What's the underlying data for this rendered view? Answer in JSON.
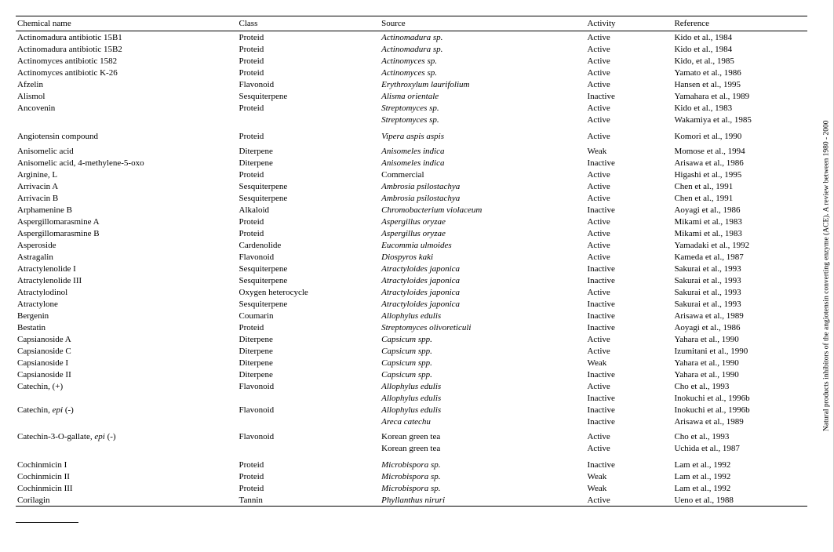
{
  "side_label": "Natural products inhibitors of the angiotensin converting enzyme (ACE). A review between 1980 - 2000",
  "table": {
    "headers": [
      "Chemical name",
      "Class",
      "Source",
      "Activity",
      "Reference"
    ],
    "rows": [
      [
        "Actinomadura antibiotic 15B1",
        "Proteid",
        "Actinomadura sp.",
        "Active",
        "Kido et al., 1984"
      ],
      [
        "Actinomadura antibiotic 15B2",
        "Proteid",
        "Actinomadura sp.",
        "Active",
        "Kido et al., 1984"
      ],
      [
        "Actinomyces antibiotic 1582",
        "Proteid",
        "Actinomyces sp.",
        "Active",
        "Kido, et al., 1985"
      ],
      [
        "Actinomyces antibiotic K-26",
        "Proteid",
        "Actinomyces sp.",
        "Active",
        "Yamato et al., 1986"
      ],
      [
        "Afzelin",
        "Flavonoid",
        "Erythroxylum laurifolium",
        "Active",
        "Hansen et al., 1995"
      ],
      [
        "Alismol",
        "Sesquiterpene",
        "Alisma orientale",
        "Inactive",
        "Yamahara et al., 1989"
      ],
      [
        "Ancovenin",
        "Proteid",
        "Streptomyces sp.",
        "Active",
        "Kido et al., 1983"
      ],
      [
        "",
        "",
        "Streptomyces sp.",
        "Active",
        "Wakamiya et al., 1985"
      ],
      [
        "Angiotensin compound",
        "Proteid",
        "Vipera aspis aspis",
        "Active",
        "Komori et al., 1990"
      ],
      [
        "Anisomelic acid",
        "Diterpene",
        "Anisomeles indica",
        "Weak",
        "Momose et al., 1994"
      ],
      [
        "Anisomelic acid, 4-methylene-5-oxo",
        "Diterpene",
        "Anisomeles indica",
        "Inactive",
        "Arisawa et al., 1986"
      ],
      [
        "Arginine, L",
        "Proteid",
        "Commercial",
        "Active",
        "Higashi et al., 1995"
      ],
      [
        "Arrivacin A",
        "Sesquiterpene",
        "Ambrosia psilostachya",
        "Active",
        "Chen et al., 1991"
      ],
      [
        "Arrivacin B",
        "Sesquiterpene",
        "Ambrosia psilostachya",
        "Active",
        "Chen et al., 1991"
      ],
      [
        "Arphamenine B",
        "Alkaloid",
        "Chromobacterium violaceum",
        "Inactive",
        "Aoyagi et al., 1986"
      ],
      [
        "Aspergillomarasmine A",
        "Proteid",
        "Aspergillus oryzae",
        "Active",
        "Mikami et al., 1983"
      ],
      [
        "Aspergillomarasmine B",
        "Proteid",
        "Aspergillus oryzae",
        "Active",
        "Mikami et al., 1983"
      ],
      [
        "Asperoside",
        "Cardenolide",
        "Eucommia ulmoides",
        "Active",
        "Yamadaki et al., 1992"
      ],
      [
        "Astragalin",
        "Flavonoid",
        "Diospyros kaki",
        "Active",
        "Kameda et al., 1987"
      ],
      [
        "Atractylenolide I",
        "Sesquiterpene",
        "Atractyloides japonica",
        "Inactive",
        "Sakurai et al., 1993"
      ],
      [
        "Atractylenolide III",
        "Sesquiterpene",
        "Atractyloides japonica",
        "Inactive",
        "Sakurai et al., 1993"
      ],
      [
        "Atractylodinol",
        "Oxygen heterocycle",
        "Atractyloides japonica",
        "Active",
        "Sakurai et al., 1993"
      ],
      [
        "Atractylone",
        "Sesquiterpene",
        "Atractyloides japonica",
        "Inactive",
        "Sakurai et al., 1993"
      ],
      [
        "Bergenin",
        "Coumarin",
        "Allophylus edulis",
        "Inactive",
        "Arisawa et al., 1989"
      ],
      [
        "Bestatin",
        "Proteid",
        "Streptomyces olivoreticuli",
        "Inactive",
        "Aoyagi et al., 1986"
      ],
      [
        "Capsianoside A",
        "Diterpene",
        "Capsicum spp.",
        "Active",
        "Yahara et al., 1990"
      ],
      [
        "Capsianoside C",
        "Diterpene",
        "Capsicum spp.",
        "Active",
        "Izumitani et al., 1990"
      ],
      [
        "Capsianoside I",
        "Diterpene",
        "Capsicum spp.",
        "Weak",
        "Yahara et al., 1990"
      ],
      [
        "Capsianoside II",
        "Diterpene",
        "Capsicum spp.",
        "Inactive",
        "Yahara et al., 1990"
      ],
      [
        "Catechin, (+)",
        "Flavonoid",
        "Allophylus edulis",
        "Active",
        "Cho et al., 1993"
      ],
      [
        "",
        "",
        "Allophylus edulis",
        "Inactive",
        "Inokuchi et al., 1996b"
      ],
      [
        "Catechin, epi (-)",
        "Flavonoid",
        "Allophylus edulis",
        "Inactive",
        "Inokuchi et al., 1996b"
      ],
      [
        "",
        "",
        "Areca catechu",
        "Inactive",
        "Arisawa et al., 1989"
      ],
      [
        "Catechin-3-O-gallate, epi (-)",
        "Flavonoid",
        "Korean green tea",
        "Active",
        "Cho et al., 1993"
      ],
      [
        "",
        "",
        "Korean green tea",
        "Active",
        "Uchida et al., 1987"
      ],
      [
        "Cochinmicin I",
        "Proteid",
        "Microbispora sp.",
        "Inactive",
        "Lam et al., 1992"
      ],
      [
        "Cochinmicin II",
        "Proteid",
        "Microbispora sp.",
        "Weak",
        "Lam et al., 1992"
      ],
      [
        "Cochinmicin III",
        "Proteid",
        "Microbispora sp.",
        "Weak",
        "Lam et al., 1992"
      ],
      [
        "Corilagin",
        "Tannin",
        "Phyllanthus niruri",
        "Active",
        "Ueno et al., 1988"
      ]
    ]
  },
  "italic_sources": [
    "Actinomadura sp.",
    "Actinomadura sp.",
    "Actinomyces sp.",
    "Actinomyces sp.",
    "Erythroxylum laurifolium",
    "Alisma orientale",
    "Streptomyces sp.",
    "Streptomyces sp.",
    "Vipera aspis aspis",
    "Anisomeles indica",
    "Anisomeles indica",
    "Ambrosia psilostachya",
    "Ambrosia psilostachya",
    "Chromobacterium violaceum",
    "Aspergillus oryzae",
    "Aspergillus oryzae",
    "Eucommia ulmoides",
    "Diospyros kaki",
    "Atractyloides japonica",
    "Atractyloides japonica",
    "Atractyloides japonica",
    "Atractyloides japonica",
    "Allophylus edulis",
    "Streptomyces olivoreticuli",
    "Capsicum spp.",
    "Capsicum spp.",
    "Capsicum spp.",
    "Capsicum spp.",
    "Allophylus edulis",
    "Allophylus edulis",
    "Allophylus edulis",
    "Areca catechu",
    "Microbispora sp.",
    "Microbispora sp.",
    "Microbispora sp.",
    "Phyllanthus niruri"
  ],
  "non_italic_sources": [
    "Commercial",
    "Korean green tea",
    "Korean green tea"
  ]
}
